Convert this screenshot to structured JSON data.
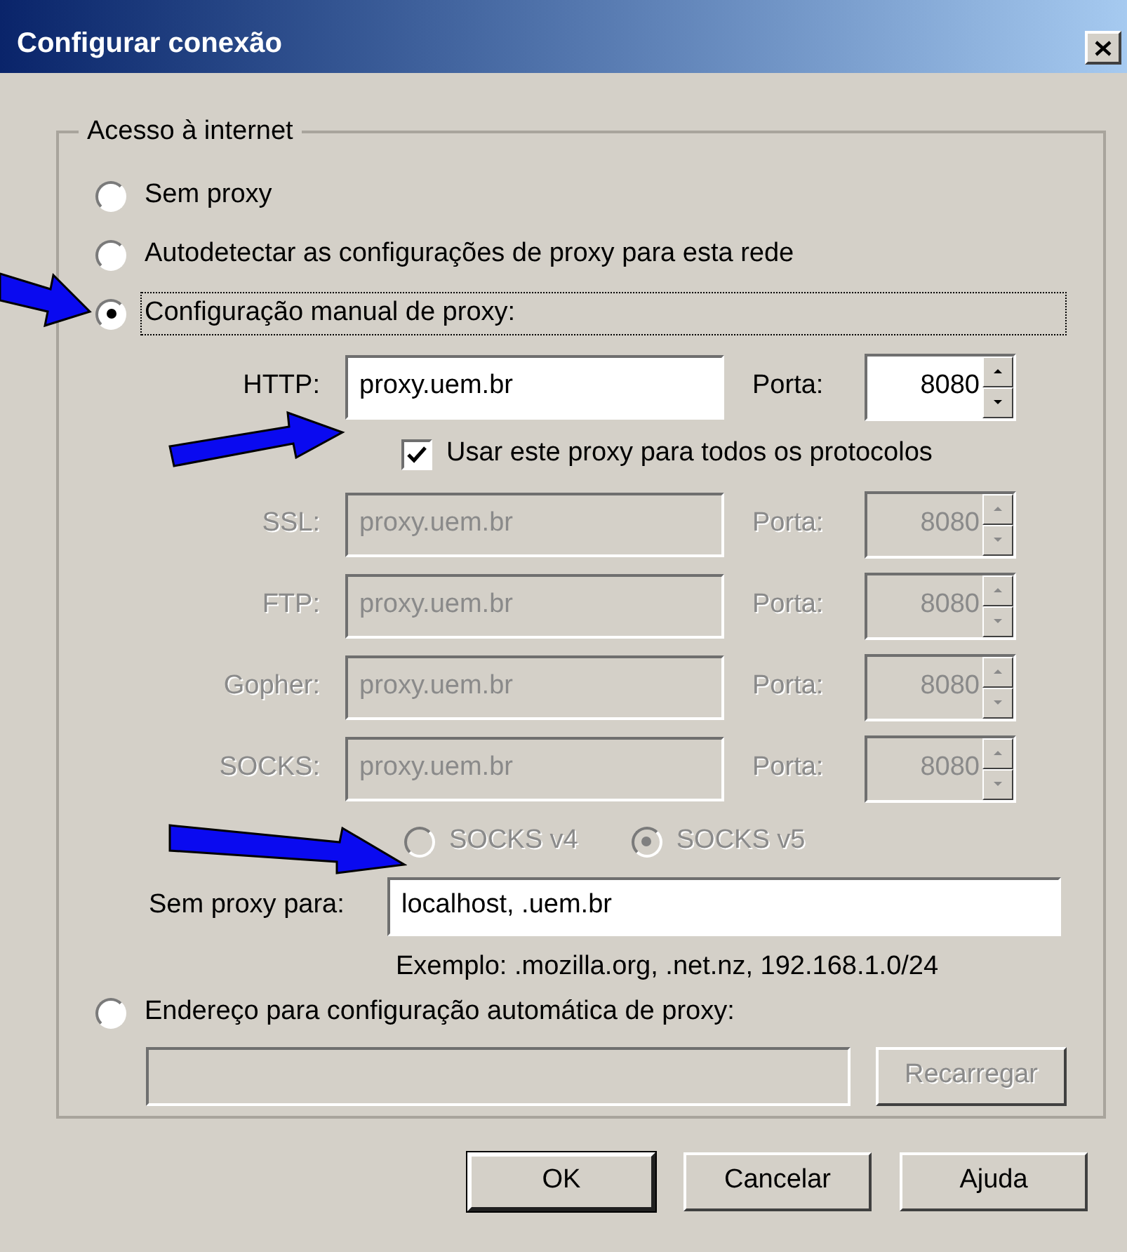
{
  "window": {
    "title": "Configurar conexão"
  },
  "group": {
    "title": "Acesso à internet"
  },
  "modes": [
    {
      "kind": "plain",
      "label": "Sem proxy",
      "selected": false,
      "focused": false
    },
    {
      "kind": "plain",
      "label": "Autodetectar as configurações de proxy para esta rede",
      "selected": false,
      "focused": false
    },
    {
      "kind": "manual",
      "label": "Configuração manual de proxy:",
      "selected": true,
      "focused": true
    },
    {
      "kind": "auto_url",
      "label": "Endereço para configuração automática de proxy:",
      "selected": false,
      "focused": false
    }
  ],
  "manual": {
    "protocols": [
      {
        "label": "HTTP:",
        "value": "proxy.uem.br",
        "port_label": "Porta:",
        "port": "8080",
        "disabled": false
      },
      {
        "label": "SSL:",
        "value": "proxy.uem.br",
        "port_label": "Porta:",
        "port": "8080",
        "disabled": true
      },
      {
        "label": "FTP:",
        "value": "proxy.uem.br",
        "port_label": "Porta:",
        "port": "8080",
        "disabled": true
      },
      {
        "label": "Gopher:",
        "value": "proxy.uem.br",
        "port_label": "Porta:",
        "port": "8080",
        "disabled": true
      },
      {
        "label": "SOCKS:",
        "value": "proxy.uem.br",
        "port_label": "Porta:",
        "port": "8080",
        "disabled": true
      }
    ],
    "share_all": {
      "label": "Usar este proxy para todos os protocolos",
      "checked": true
    },
    "socks_versions": [
      {
        "label": "SOCKS v4",
        "selected": false,
        "disabled": true
      },
      {
        "label": "SOCKS v5",
        "selected": true,
        "disabled": true
      }
    ],
    "no_proxy": {
      "label": "Sem proxy para:",
      "value": "localhost, .uem.br"
    },
    "example": "Exemplo: .mozilla.org, .net.nz, 192.168.1.0/24"
  },
  "auto_url": {
    "disabled": true,
    "reload_button": {
      "label": "Recarregar",
      "disabled": true
    }
  },
  "buttons": [
    {
      "label": "OK",
      "default": true
    },
    {
      "label": "Cancelar",
      "default": false
    },
    {
      "label": "Ajuda",
      "default": false
    }
  ]
}
